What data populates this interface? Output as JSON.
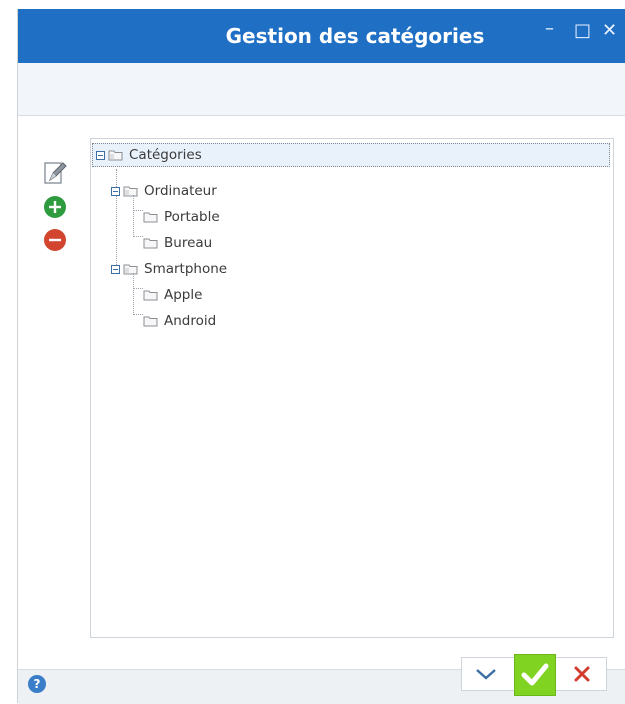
{
  "window": {
    "title": "Gestion des catégories",
    "controls": {
      "minimize": "–",
      "maximize": "□",
      "close": "✕"
    }
  },
  "side_tools": [
    {
      "name": "edit",
      "icon": "edit-icon"
    },
    {
      "name": "add",
      "icon": "plus-circle-icon",
      "color": "#2e9b3f"
    },
    {
      "name": "remove",
      "icon": "minus-circle-icon",
      "color": "#d2452f"
    }
  ],
  "tree": {
    "root": "Catégories",
    "children": [
      {
        "label": "Ordinateur",
        "children": [
          "Portable",
          "Bureau"
        ]
      },
      {
        "label": "Smartphone",
        "children": [
          "Apple",
          "Android"
        ]
      }
    ]
  },
  "footer": {
    "help": "?",
    "buttons": {
      "expand": "chevron-down-icon",
      "ok": "check-icon",
      "cancel": "x-icon"
    }
  },
  "colors": {
    "titlebar": "#1f6fc5",
    "ok_button": "#81d321",
    "cancel_x": "#d33b2f",
    "help": "#3a7dc9"
  }
}
